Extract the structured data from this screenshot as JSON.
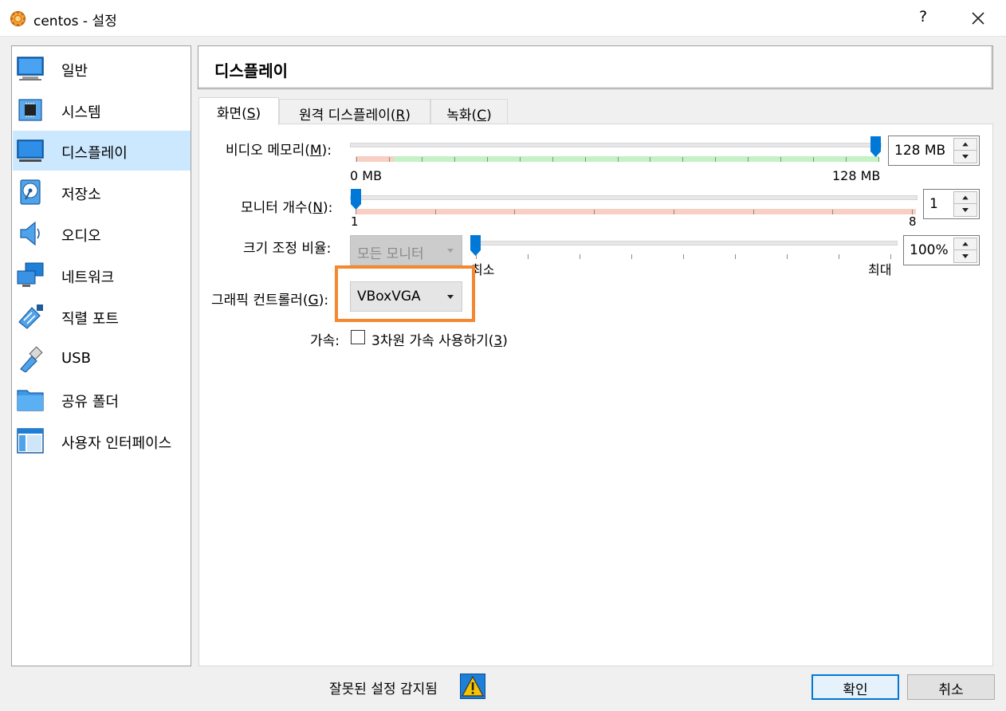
{
  "window": {
    "title": "centos - 설정",
    "help_label": "?"
  },
  "sidebar": {
    "items": [
      {
        "label": "일반"
      },
      {
        "label": "시스템"
      },
      {
        "label": "디스플레이"
      },
      {
        "label": "저장소"
      },
      {
        "label": "오디오"
      },
      {
        "label": "네트워크"
      },
      {
        "label": "직렬 포트"
      },
      {
        "label": "USB"
      },
      {
        "label": "공유 폴더"
      },
      {
        "label": "사용자 인터페이스"
      }
    ],
    "selected_index": 2
  },
  "page": {
    "title": "디스플레이"
  },
  "tabs": [
    {
      "label_pre": "화면(",
      "mnemonic": "S",
      "label_post": ")"
    },
    {
      "label_pre": "원격 디스플레이(",
      "mnemonic": "R",
      "label_post": ")"
    },
    {
      "label_pre": "녹화(",
      "mnemonic": "C",
      "label_post": ")"
    }
  ],
  "screen": {
    "video_memory": {
      "label_pre": "비디오 메모리(",
      "mnemonic": "M",
      "label_post": "):",
      "value": "128 MB",
      "min_label": "0 MB",
      "max_label": "128 MB",
      "fraction": 1.0
    },
    "monitor_count": {
      "label_pre": "모니터 개수(",
      "mnemonic": "N",
      "label_post": "):",
      "value": "1",
      "min_label": "1",
      "max_label": "8",
      "fraction": 0.0
    },
    "scale_factor": {
      "label": "크기 조정 비율:",
      "combo_value": "모든 모니터",
      "value": "100%",
      "min_label": "최소",
      "max_label": "최대",
      "fraction": 0.0
    },
    "graphics_controller": {
      "label_pre": "그래픽 컨트롤러(",
      "mnemonic": "G",
      "label_post": "):",
      "value": "VBoxVGA"
    },
    "acceleration": {
      "label": "가속:",
      "checkbox_pre": "3차원 가속 사용하기(",
      "mnemonic": "3",
      "checkbox_post": ")",
      "checked": false
    }
  },
  "footer": {
    "warning_text": "잘못된 설정 감지됨",
    "ok_label": "확인",
    "cancel_label": "취소"
  },
  "colors": {
    "selection": "#cce8ff",
    "slider_thumb": "#0078d7",
    "highlight": "#f5882e",
    "warning_icon": "#f5c400"
  }
}
